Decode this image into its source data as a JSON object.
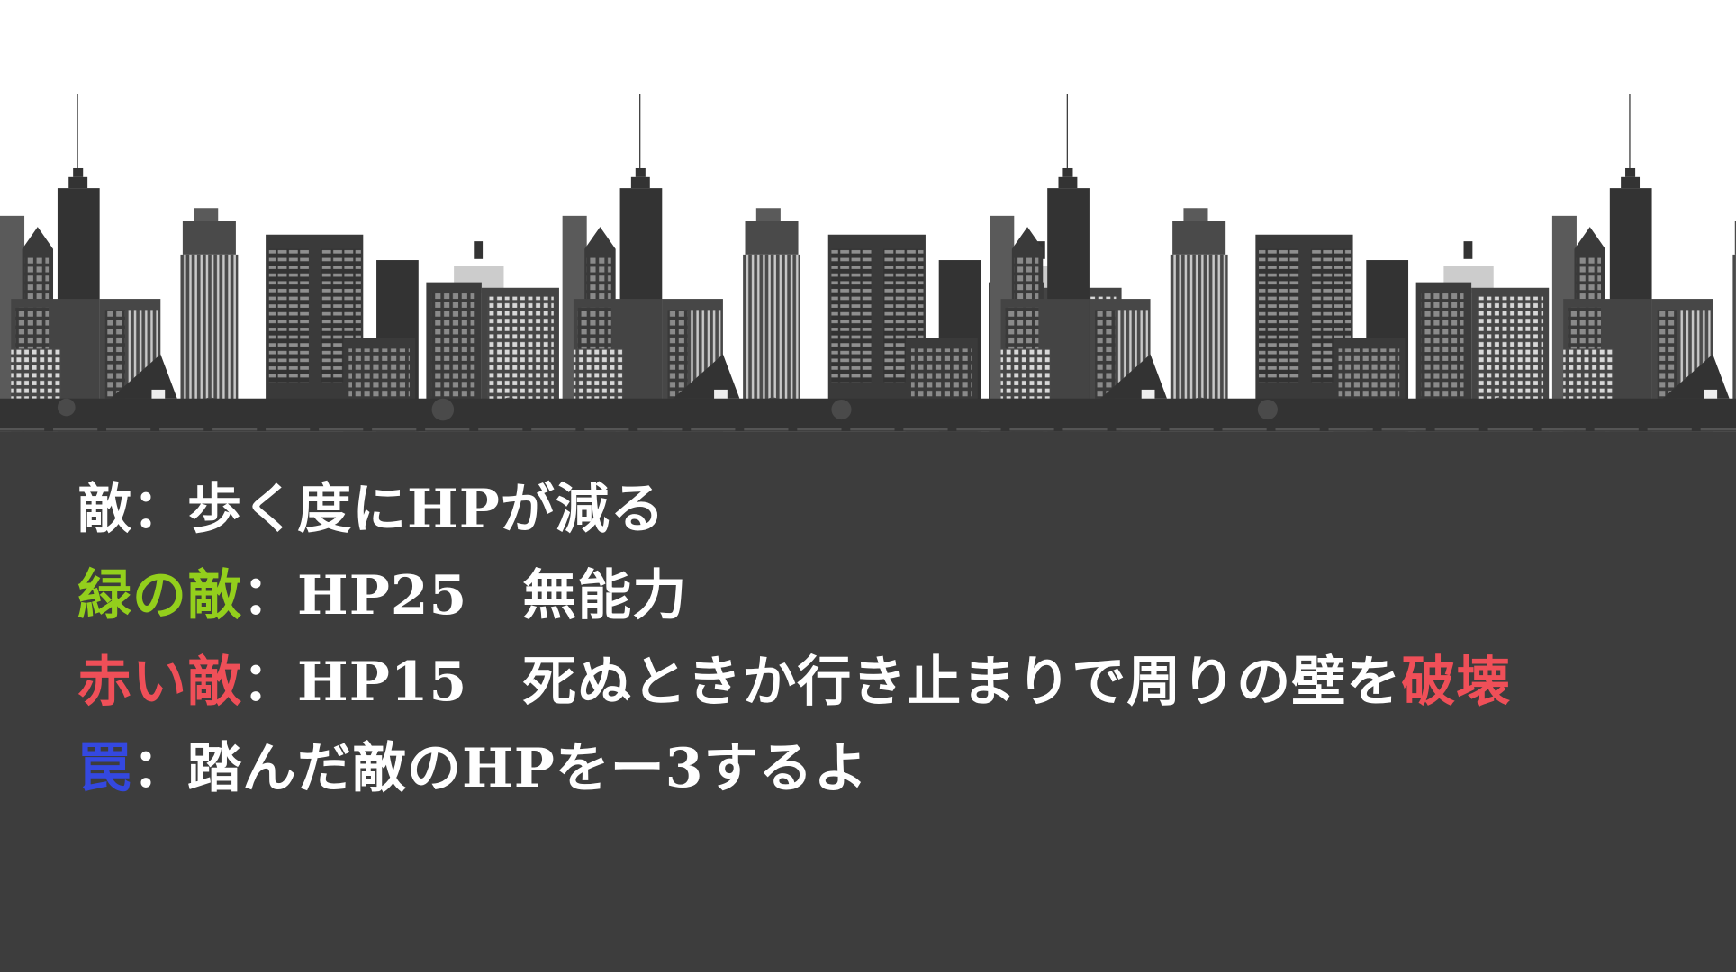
{
  "colors": {
    "background": "#3d3d3d",
    "green": "#93cf1c",
    "red": "#ef4f58",
    "blue": "#3448e0",
    "text": "#ffffff"
  },
  "lines": [
    {
      "parts": [
        {
          "text": "敵",
          "color": "text"
        },
        {
          "text": "：歩く度にHPが減る",
          "color": "text"
        }
      ]
    },
    {
      "parts": [
        {
          "text": "緑の敵",
          "color": "green"
        },
        {
          "text": "：HP25　無能力",
          "color": "text"
        }
      ]
    },
    {
      "parts": [
        {
          "text": "赤い敵",
          "color": "red"
        },
        {
          "text": "：HP15　死ぬときか行き止まりで周りの壁を",
          "color": "text"
        },
        {
          "text": "破壊",
          "color": "red"
        }
      ]
    },
    {
      "parts": [
        {
          "text": "罠",
          "color": "blue"
        },
        {
          "text": "：踏んだ敵のHPをー3するよ",
          "color": "text"
        }
      ]
    }
  ]
}
